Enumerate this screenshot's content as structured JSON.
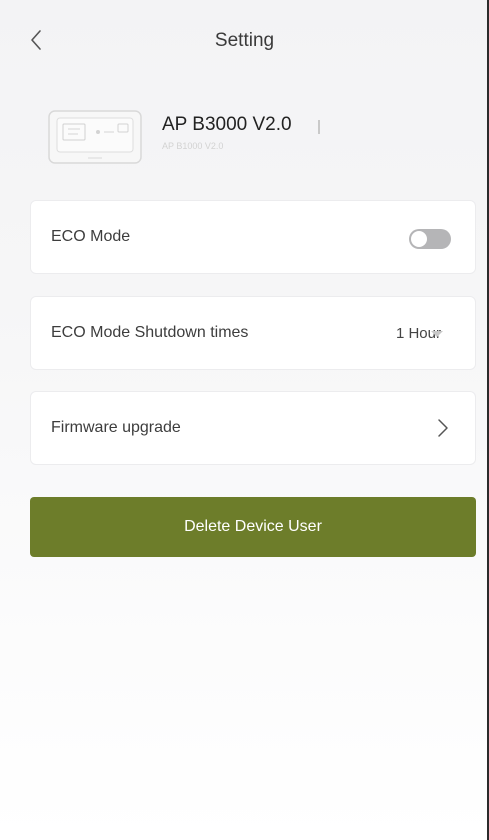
{
  "header": {
    "title": "Setting",
    "back_icon": "chevron-left-icon"
  },
  "device": {
    "name": "AP B3000 V2.0",
    "model": "AP B1000 V2.0",
    "image_icon": "power-station-icon"
  },
  "settings": {
    "eco_mode": {
      "label": "ECO Mode",
      "enabled": false
    },
    "eco_shutdown": {
      "label": "ECO Mode Shutdown times",
      "value": "1 Hour",
      "icon": "dropdown-arrow-icon"
    },
    "firmware": {
      "label": "Firmware upgrade",
      "icon": "chevron-right-icon"
    }
  },
  "actions": {
    "delete_label": "Delete Device User"
  },
  "colors": {
    "accent": "#6d7d2a",
    "toggle_off": "#b5b5b7",
    "text": "#333333"
  }
}
